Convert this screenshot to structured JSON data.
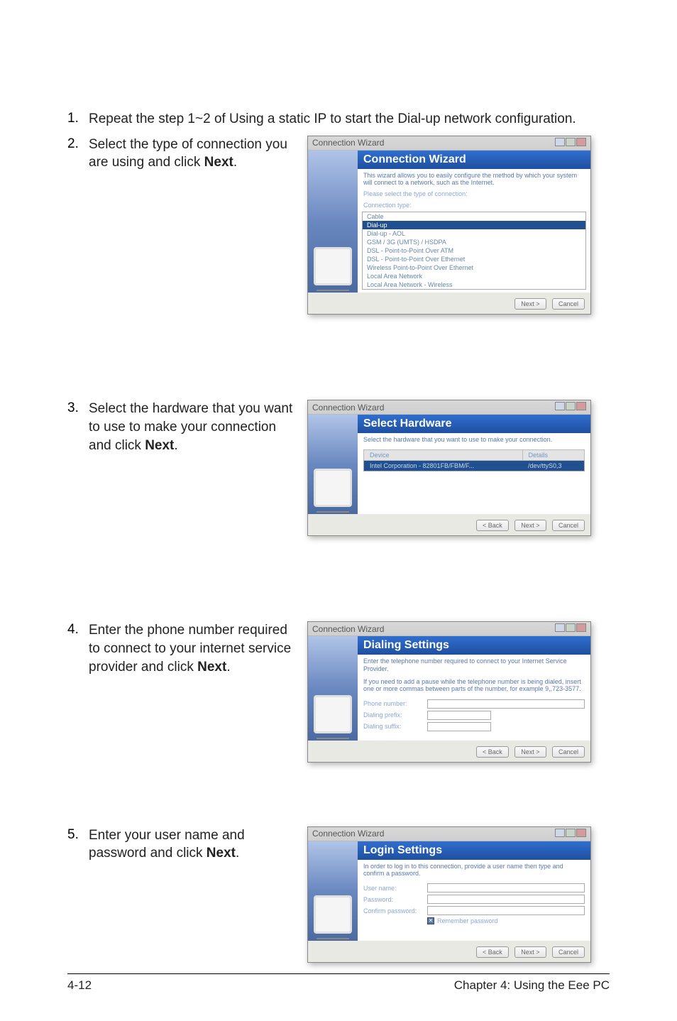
{
  "steps": [
    {
      "num": "1.",
      "text_pre": "Repeat the step 1~2 of Using a static IP to start the Dial-up network configuration."
    },
    {
      "num": "2.",
      "text_pre": "Select the type of connection you are using and click ",
      "bold": "Next",
      "text_post": "."
    },
    {
      "num": "3.",
      "text_pre": "Select the hardware that you want to use to make your connection and click ",
      "bold": "Next",
      "text_post": "."
    },
    {
      "num": "4.",
      "text_pre": "Enter the phone number required to connect to your internet service provider and click ",
      "bold": "Next",
      "text_post": "."
    },
    {
      "num": "5.",
      "text_pre": "Enter your user name and password and click ",
      "bold": "Next",
      "text_post": "."
    }
  ],
  "dlg2": {
    "title": "Connection Wizard",
    "header": "Connection Wizard",
    "desc": "This wizard allows you to easily configure the method by which your system will connect to a network, such as the Internet.",
    "sub": "Please select the type of connection:",
    "type_label": "Connection type:",
    "items": [
      "Cable",
      "Dial-up",
      "Dial-up - AOL",
      "GSM / 3G (UMTS) / HSDPA",
      "DSL - Point-to-Point Over ATM",
      "DSL - Point-to-Point Over Ethernet",
      "Wireless Point-to-Point Over Ethernet",
      "Local Area Network",
      "Local Area Network - Wireless"
    ],
    "sel_index": 1,
    "btn_next": "Next >",
    "btn_cancel": "Cancel"
  },
  "dlg3": {
    "title": "Connection Wizard",
    "header": "Select Hardware",
    "desc": "Select the hardware that you want to use to make your connection.",
    "col1": "Device",
    "col2": "Details",
    "row_device": "Intel Corporation - 82801FB/FBM/F...",
    "row_details": "/dev/ttyS0,3",
    "btn_back": "< Back",
    "btn_next": "Next >",
    "btn_cancel": "Cancel"
  },
  "dlg4": {
    "title": "Connection Wizard",
    "header": "Dialing Settings",
    "desc": "Enter the telephone number required to connect to your Internet Service Provider.",
    "desc2": "If you need to add a pause while the telephone number is being dialed, insert one or more commas between parts of the number, for example 9,,723-3577.",
    "lbl_phone": "Phone number:",
    "lbl_prefix": "Dialing prefix:",
    "lbl_suffix": "Dialing suffix:",
    "btn_back": "< Back",
    "btn_next": "Next >",
    "btn_cancel": "Cancel"
  },
  "dlg5": {
    "title": "Connection Wizard",
    "header": "Login Settings",
    "desc": "In order to log in to this connection, provide a user name then type and confirm a password.",
    "lbl_user": "User name:",
    "lbl_pass": "Password:",
    "lbl_conf": "Confirm password:",
    "cb": "Remember password",
    "btn_back": "< Back",
    "btn_next": "Next >",
    "btn_cancel": "Cancel"
  },
  "footer": {
    "left": "4-12",
    "right": "Chapter 4: Using the Eee PC"
  }
}
